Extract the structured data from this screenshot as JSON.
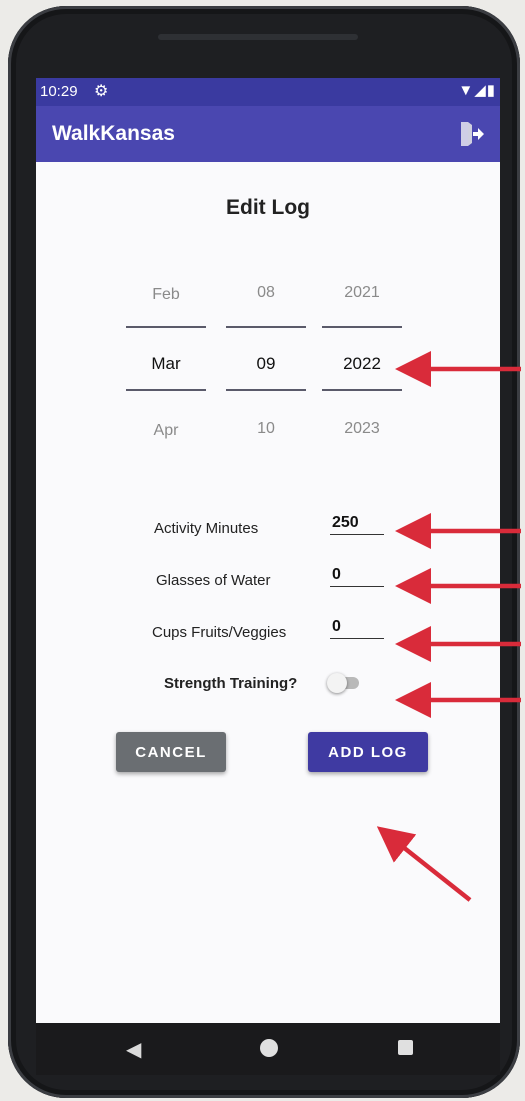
{
  "status_bar": {
    "time": "10:29",
    "icons": [
      "settings-icon",
      "wifi-icon",
      "signal-icon",
      "battery-icon"
    ]
  },
  "app_bar": {
    "title": "WalkKansas",
    "logout_icon": "logout-icon"
  },
  "page": {
    "title": "Edit Log"
  },
  "date_picker": {
    "month": {
      "prev": "Feb",
      "selected": "Mar",
      "next": "Apr"
    },
    "day": {
      "prev": "08",
      "selected": "09",
      "next": "10"
    },
    "year": {
      "prev": "2021",
      "selected": "2022",
      "next": "2023"
    }
  },
  "form": {
    "activity_minutes_label": "Activity Minutes",
    "activity_minutes_value": "250",
    "water_label": "Glasses of Water",
    "water_value": "0",
    "fruits_label": "Cups Fruits/Veggies",
    "fruits_value": "0",
    "strength_label": "Strength Training?",
    "strength_on": false
  },
  "buttons": {
    "cancel": "CANCEL",
    "add_log": "ADD LOG"
  },
  "annotations": {
    "arrow_color": "#d92b3a"
  },
  "nav_bar": {
    "icons": [
      "back-icon",
      "home-icon",
      "recents-icon"
    ]
  },
  "colors": {
    "primary": "#4a47b0",
    "status_bar": "#3a3aa0",
    "accent_button": "#3f3aa2",
    "cancel_button": "#6a6e72"
  }
}
